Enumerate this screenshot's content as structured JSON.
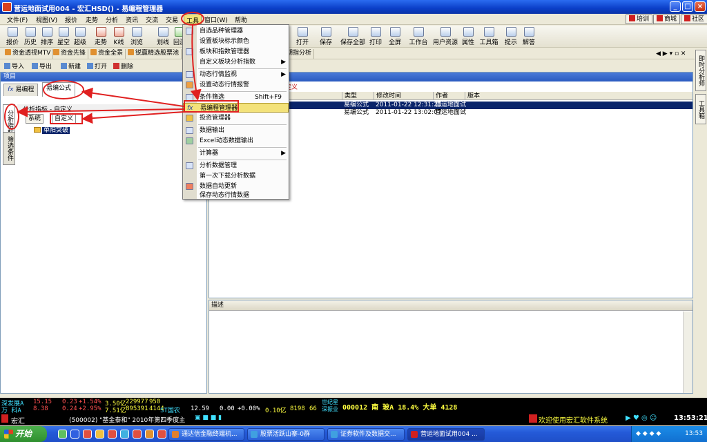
{
  "window": {
    "title": "营运地面试用004 - 宏汇HSD() - 易编程管理器"
  },
  "menubar": {
    "items": [
      "文件(F)",
      "视图(V)",
      "报价",
      "走势",
      "分析",
      "资讯",
      "交流",
      "交易",
      "工具",
      "窗口(W)",
      "帮助"
    ],
    "right_buttons": [
      "培训",
      "商城",
      "社区"
    ]
  },
  "toolbar": {
    "items": [
      "报价",
      "历史",
      "排序",
      "星空",
      "超级",
      "走势",
      "K线",
      "浏览",
      "划线",
      "回测",
      "打开",
      "保存",
      "保存全部",
      "打印",
      "全屏",
      "工作台",
      "用户资源",
      "属性",
      "工具箱",
      "提示",
      "解答"
    ]
  },
  "quickbar": {
    "items": [
      "资金透视MTV",
      "资金先锋",
      "资金全景",
      "锐赢精选股票池",
      "期指分析"
    ]
  },
  "project_tools": {
    "items": [
      "导入",
      "导出",
      "新建",
      "打开",
      "删除"
    ]
  },
  "left_panel": {
    "header": "项目",
    "tabs": [
      "易编程",
      "易编公式"
    ],
    "vertical_tabs": [
      "分析指标",
      "筛选条件"
    ],
    "category_line": "分析指标 - 自定义",
    "subtabs": [
      "系统",
      "自定义"
    ],
    "tree_item": "单阳突破"
  },
  "right_panel": {
    "subtitle": "定义",
    "columns": [
      "类型",
      "修改时间",
      "作者",
      "版本"
    ],
    "rows": [
      {
        "type": "易编公式",
        "time": "2011-01-22 12:31:25",
        "author": "营运地面试",
        "version": ""
      },
      {
        "type": "易编公式",
        "time": "2011-01-22 13:02:07",
        "author": "营运地面试",
        "version": ""
      }
    ],
    "desc_header": "描述"
  },
  "side_tabs": [
    "即时分析师",
    "工具箱"
  ],
  "dropdown": {
    "items": [
      {
        "label": "自选品种管理器",
        "shortcut": "",
        "submenu": false
      },
      {
        "label": "设置板块标示颜色",
        "shortcut": "",
        "submenu": false
      },
      {
        "label": "板块和指数管理器",
        "shortcut": "",
        "submenu": false
      },
      {
        "label": "自定义板块分析指数",
        "shortcut": "",
        "submenu": true
      },
      {
        "label": "动态行情监视",
        "shortcut": "",
        "submenu": true
      },
      {
        "label": "设置动态行情报警",
        "shortcut": "",
        "submenu": false
      },
      {
        "label": "条件筛选",
        "shortcut": "Shift+F9",
        "submenu": false
      },
      {
        "label": "易编程管理器",
        "shortcut": "",
        "submenu": false
      },
      {
        "label": "投资管理器",
        "shortcut": "",
        "submenu": false
      },
      {
        "label": "数据输出",
        "shortcut": "",
        "submenu": false
      },
      {
        "label": "Excel动态数据输出",
        "shortcut": "",
        "submenu": false
      },
      {
        "label": "计算器",
        "shortcut": "",
        "submenu": true
      },
      {
        "label": "分析数据管理",
        "shortcut": "",
        "submenu": false
      },
      {
        "label": "第一次下载分析数据",
        "shortcut": "",
        "submenu": false
      },
      {
        "label": "数据自动更新",
        "shortcut": "",
        "submenu": false
      },
      {
        "label": "保存动态行情数据",
        "shortcut": "",
        "submenu": false
      }
    ]
  },
  "ticker": {
    "row1": [
      "深发展A",
      "15.15",
      "0.23",
      "+1.54%",
      "3.50亿",
      "229977",
      "950"
    ],
    "row2": [
      "万 科A",
      "8.38",
      "0.24",
      "+2.95%",
      "7.51亿",
      "895391",
      "4144"
    ],
    "mid": [
      "ST国农",
      "12.59",
      "0.00",
      "+0.00%",
      "0.10亿",
      "8198",
      "66"
    ],
    "right_tag": [
      "世纪星",
      "深振业"
    ],
    "right_text": "000012 南 玻A 18.4% 大单 4128"
  },
  "statusbar": {
    "brand": "宏汇",
    "news": "(500002) \"基金泰和\" 2010年第四季度主",
    "welcome": "欢迎使用宏汇软件系统",
    "time": "13:53:21"
  },
  "taskbar": {
    "start": "开始",
    "tasks": [
      "通达信金融终端机...",
      "股票活跃山寨-0群",
      "证券软件及数据交...",
      "营运地面试用004 ..."
    ],
    "clock": "13:53"
  },
  "colors": {
    "accent": "#e02020",
    "title_blue": "#0b3fc8",
    "selection": "#0a246a",
    "menu_highlight": "#f3e27a"
  }
}
